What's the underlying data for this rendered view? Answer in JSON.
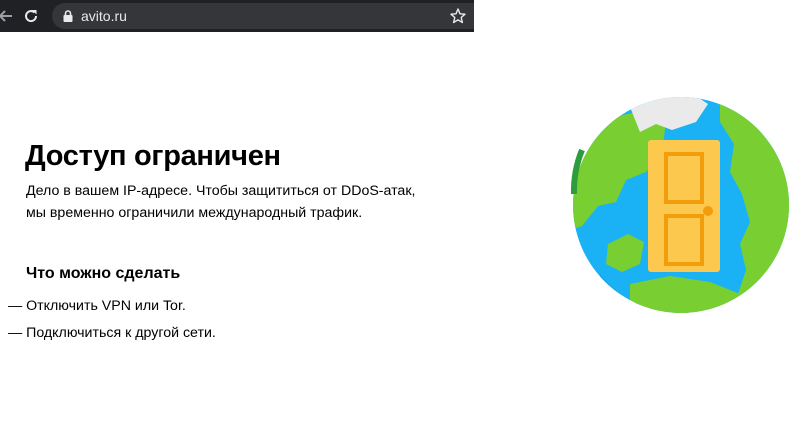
{
  "browser": {
    "url": "avito.ru",
    "icons": {
      "back": "arrow-back-icon",
      "reload": "reload-icon",
      "lock": "lock-icon",
      "bookmark": "star-icon"
    }
  },
  "page": {
    "title": "Доступ ограничен",
    "description": [
      "Дело в вашем IP-адресе. Чтобы защититься от DDoS-атак,",
      "мы временно ограничили международный трафик."
    ],
    "subheading": "Что можно сделать",
    "actions": [
      "— Отключить VPN или Tor.",
      "— Подключиться к другой сети."
    ],
    "illustration": "globe-with-door-icon"
  },
  "colors": {
    "browser_bar": "#202124",
    "omnibox": "#35363a",
    "ocean": "#1ab1f5",
    "land": "#79cf31",
    "door": "#fdc84e",
    "door_frame": "#f29d0c"
  }
}
